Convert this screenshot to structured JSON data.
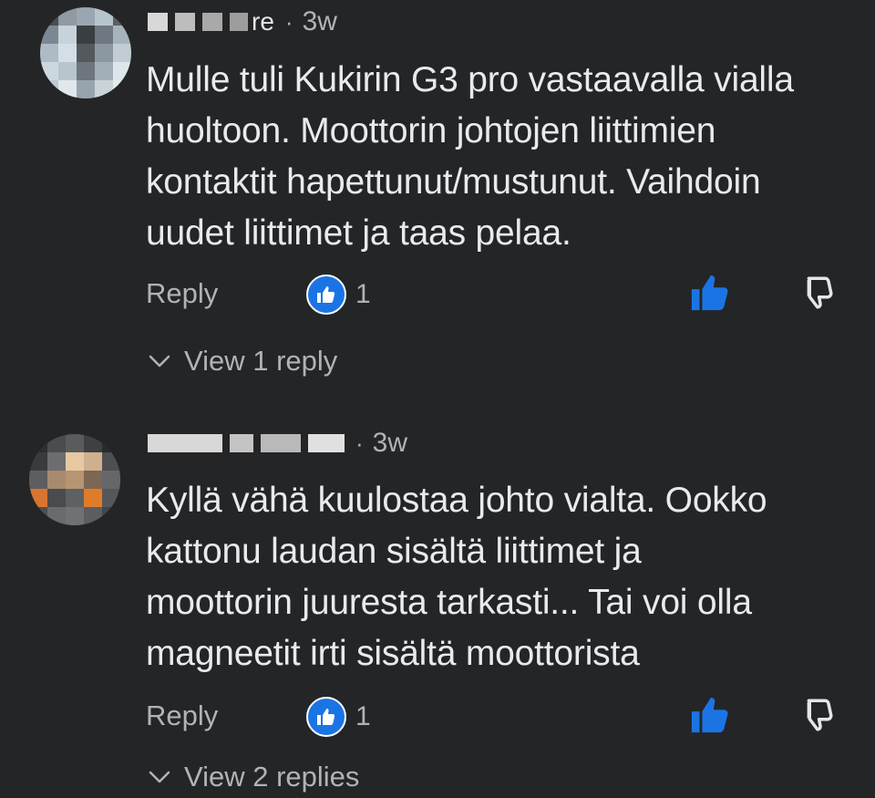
{
  "comments": [
    {
      "author_suffix": "re",
      "separator": "·",
      "time": "3w",
      "text_lines": [
        "Mulle tuli Kukirin G3 pro vastaavalla vialla",
        "huoltoon. Moottorin johtojen liittimien",
        "kontaktit hapettunut/mustunut. Vaihdoin",
        "uudet liittimet ja taas pelaa."
      ],
      "reply_label": "Reply",
      "reaction_count": "1",
      "view_replies_label": "View 1 reply"
    },
    {
      "author_suffix": "",
      "separator": "·",
      "time": "3w",
      "text_lines": [
        "Kyllä vähä kuulostaa johto vialta. Ookko",
        "kattonu laudan sisältä liittimet ja",
        "moottorin juuresta tarkasti... Tai voi olla",
        "magneetit irti sisältä moottorista"
      ],
      "reply_label": "Reply",
      "reaction_count": "1",
      "view_replies_label": "View 2 replies"
    }
  ],
  "icons": {
    "reaction": "thumbs-up-reaction-icon",
    "like": "thumbs-up-icon",
    "dislike": "thumbs-down-icon",
    "expand": "chevron-down-icon"
  },
  "colors": {
    "background": "#242526",
    "accent": "#1b74e4",
    "text": "#e4e6eb",
    "muted": "#b0b3b8"
  }
}
